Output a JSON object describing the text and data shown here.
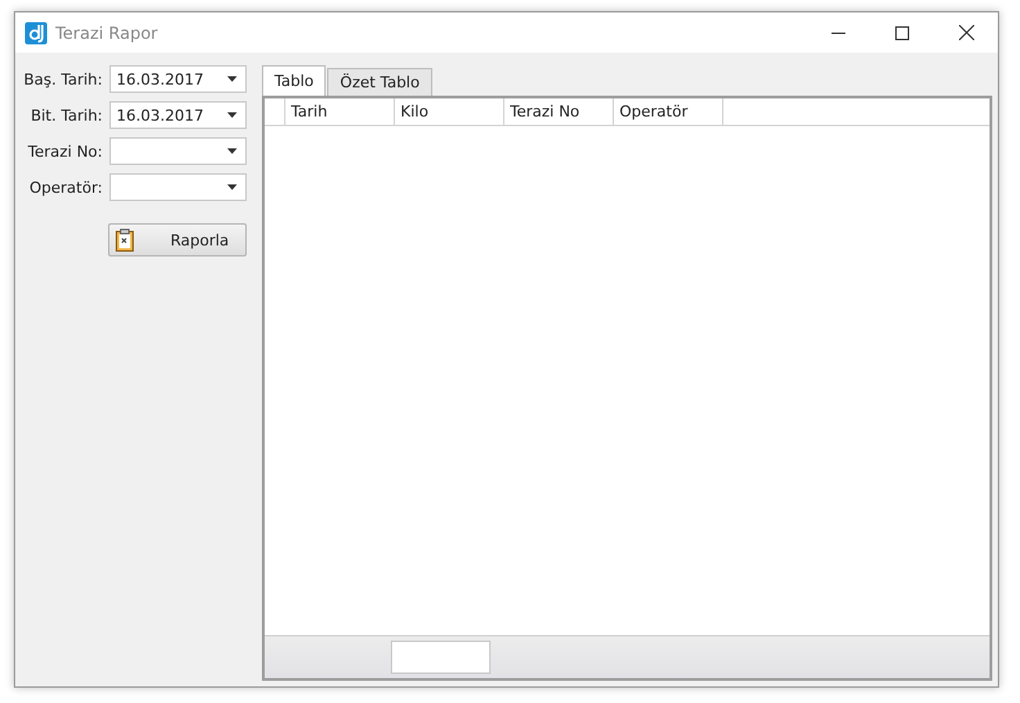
{
  "window": {
    "title": "Terazi Rapor"
  },
  "filters": [
    {
      "label": "Baş. Tarih:",
      "value": "16.03.2017"
    },
    {
      "label": "Bit. Tarih:",
      "value": "16.03.2017"
    },
    {
      "label": "Terazi No:"
    },
    {
      "label": "Operatör:"
    }
  ],
  "report_button": {
    "label": "Raporla"
  },
  "tabs": [
    {
      "label": "Tablo",
      "selected": true
    },
    {
      "label": "Özet Tablo",
      "selected": false
    }
  ],
  "table": {
    "columns": [
      "Tarih",
      "Kilo",
      "Terazi No",
      "Operatör"
    ]
  }
}
